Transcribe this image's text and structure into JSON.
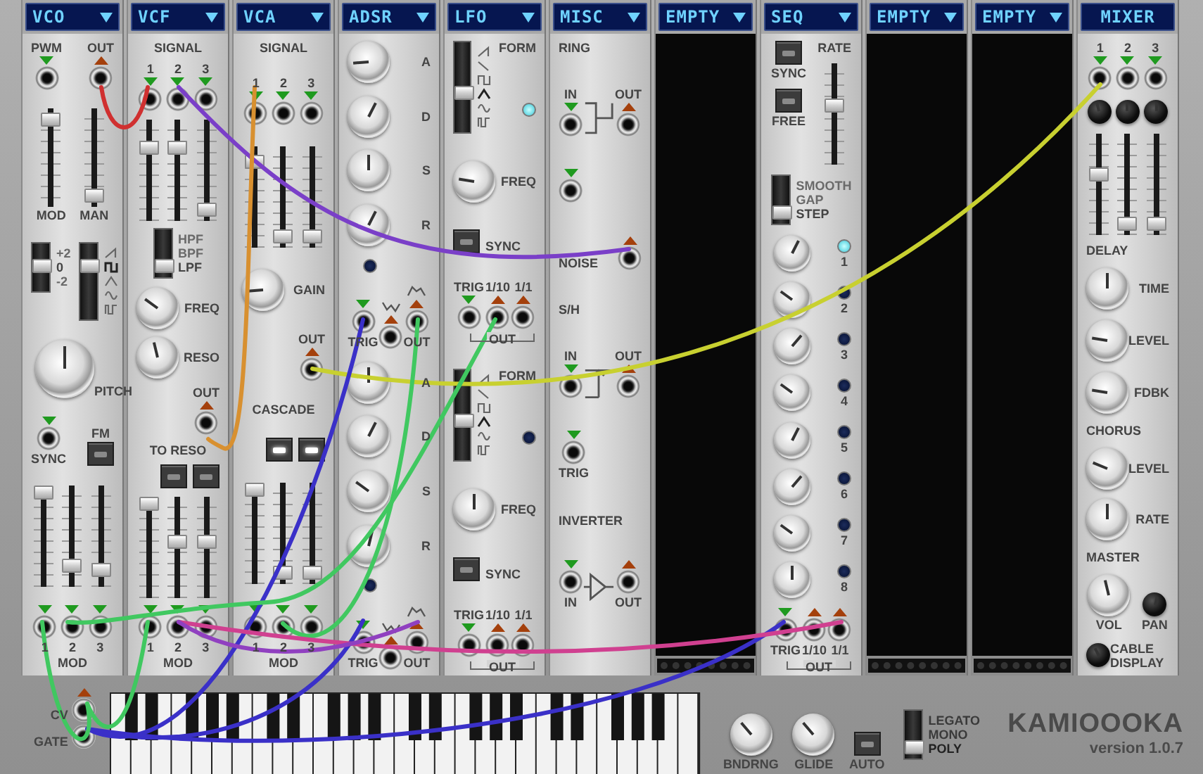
{
  "modules": [
    {
      "title": "VCO",
      "dropdown": true,
      "kind": "module",
      "rows": [
        {
          "kind": "jacks",
          "items": [
            {
              "kind": "input",
              "label": "PWM"
            },
            {
              "kind": "output",
              "label": "OUT"
            }
          ]
        },
        {
          "kind": "sliders",
          "sliders": [
            {
              "level": 0.95,
              "label": "MOD"
            },
            {
              "level": 0.05,
              "label": "MAN"
            }
          ]
        },
        {
          "kind": "columns",
          "columns": [
            [
              {
                "kind": "selector",
                "options": [
                  {
                    "text": "+2",
                    "selected": false
                  },
                  {
                    "text": "0",
                    "selected": true
                  },
                  {
                    "text": "-2",
                    "selected": false
                  }
                ]
              }
            ],
            [
              {
                "kind": "selector",
                "options": [
                  {
                    "kind": "saw",
                    "selected": false
                  },
                  {
                    "kind": "square",
                    "selected": true
                  },
                  {
                    "kind": "triangle",
                    "selected": false
                  },
                  {
                    "kind": "sine",
                    "selected": false
                  },
                  {
                    "kind": "pulse",
                    "selected": false
                  }
                ]
              }
            ]
          ]
        },
        {
          "kind": "big_knob",
          "label": "PITCH",
          "level": 0.5
        },
        {
          "kind": "jacks",
          "items": [
            {
              "kind": "input",
              "caption": "SYNC"
            },
            {
              "kind": "button",
              "label": "FM",
              "on": false
            }
          ]
        },
        {
          "kind": "sliders",
          "sliders": [
            {
              "level": 1
            },
            {
              "level": 0.15
            },
            {
              "level": 0.1
            }
          ]
        },
        {
          "kind": "jacks",
          "bottom": "MOD",
          "items": [
            {
              "kind": "input",
              "caption": "1"
            },
            {
              "kind": "input",
              "caption": "2"
            },
            {
              "kind": "input",
              "caption": "3"
            }
          ]
        }
      ]
    },
    {
      "title": "VCF",
      "dropdown": true,
      "kind": "module",
      "rows": [
        {
          "kind": "heading",
          "text": "SIGNAL"
        },
        {
          "kind": "jacks",
          "items": [
            {
              "kind": "input",
              "label": "1"
            },
            {
              "kind": "input",
              "label": "2"
            },
            {
              "kind": "input",
              "label": "3"
            }
          ]
        },
        {
          "kind": "sliders",
          "sliders": [
            {
              "level": 0.75
            },
            {
              "level": 0.75
            },
            {
              "level": 0.05
            }
          ]
        },
        {
          "kind": "selector",
          "options": [
            {
              "text": "HPF",
              "selected": false
            },
            {
              "text": "BPF",
              "selected": false
            },
            {
              "text": "LPF",
              "selected": true
            }
          ]
        },
        {
          "kind": "knob",
          "label": "FREQ",
          "level": 0.3
        },
        {
          "kind": "knob",
          "label": "RESO",
          "level": 0.45
        },
        {
          "kind": "jacks",
          "items": [
            {
              "kind": "output",
              "label": "OUT"
            }
          ]
        },
        {
          "kind": "heading",
          "text": "TO RESO"
        },
        {
          "kind": "jacks",
          "items": [
            {
              "kind": "button",
              "on": false
            },
            {
              "kind": "button",
              "on": false
            }
          ]
        },
        {
          "kind": "sliders",
          "sliders": [
            {
              "level": 1
            },
            {
              "level": 0.55
            },
            {
              "level": 0.55
            }
          ]
        },
        {
          "kind": "jacks",
          "bottom": "MOD",
          "items": [
            {
              "kind": "input",
              "caption": "1"
            },
            {
              "kind": "input",
              "caption": "2"
            },
            {
              "kind": "input",
              "caption": "3"
            }
          ]
        }
      ]
    },
    {
      "title": "VCA",
      "dropdown": true,
      "kind": "module",
      "rows": [
        {
          "kind": "heading",
          "text": "SIGNAL"
        },
        {
          "kind": "jacks",
          "items": [
            {
              "kind": "input",
              "label": "1"
            },
            {
              "kind": "input",
              "label": "2"
            },
            {
              "kind": "input",
              "label": "3"
            }
          ]
        },
        {
          "kind": "sliders",
          "sliders": [
            {
              "level": 0.9
            },
            {
              "level": 0.05
            },
            {
              "level": 0.05
            }
          ]
        },
        {
          "kind": "knob",
          "label": "GAIN",
          "level": 0.15
        },
        {
          "kind": "jacks",
          "items": [
            {
              "kind": "output",
              "label": "OUT"
            }
          ]
        },
        {
          "kind": "heading",
          "text": "CASCADE"
        },
        {
          "kind": "jacks",
          "items": [
            {
              "kind": "button",
              "on": true
            },
            {
              "kind": "button",
              "on": true
            }
          ]
        },
        {
          "kind": "sliders",
          "sliders": [
            {
              "level": 1
            },
            {
              "level": 0.05
            },
            {
              "level": 0.05
            }
          ]
        },
        {
          "kind": "jacks",
          "bottom": "MOD",
          "items": [
            {
              "kind": "input",
              "caption": "1"
            },
            {
              "kind": "input",
              "caption": "2"
            },
            {
              "kind": "input",
              "caption": "3"
            }
          ]
        }
      ]
    },
    {
      "title": "ADSR",
      "dropdown": true,
      "kind": "module",
      "rows": [
        {
          "kind": "knob",
          "label": "A",
          "level": 0.15
        },
        {
          "kind": "knob",
          "label": "D",
          "level": 0.6
        },
        {
          "kind": "knob",
          "label": "S",
          "level": 0.5
        },
        {
          "kind": "knob",
          "label": "R",
          "level": 0.6
        },
        {
          "kind": "led",
          "on": false
        },
        {
          "kind": "env_jacks",
          "items": [
            {
              "kind": "input",
              "caption": "TRIG"
            },
            {
              "kind": "output"
            },
            {
              "kind": "output",
              "caption": "OUT"
            }
          ]
        },
        {
          "kind": "knob",
          "label": "A",
          "level": 0.5
        },
        {
          "kind": "knob",
          "label": "D",
          "level": 0.6
        },
        {
          "kind": "knob",
          "label": "S",
          "level": 0.3
        },
        {
          "kind": "knob",
          "label": "R",
          "level": 0.55
        },
        {
          "kind": "led",
          "on": false
        },
        {
          "kind": "env_jacks",
          "items": [
            {
              "kind": "input",
              "caption": "TRIG"
            },
            {
              "kind": "output"
            },
            {
              "kind": "output",
              "caption": "OUT"
            }
          ]
        }
      ]
    },
    {
      "title": "LFO",
      "dropdown": true,
      "kind": "module",
      "rows": [
        {
          "kind": "selector",
          "title": "FORM",
          "led": {
            "on": true
          },
          "options": [
            {
              "kind": "saw",
              "selected": false
            },
            {
              "kind": "ramp",
              "selected": false
            },
            {
              "kind": "square",
              "selected": false
            },
            {
              "kind": "triangle",
              "selected": true
            },
            {
              "kind": "sine",
              "selected": false
            },
            {
              "kind": "pulse",
              "selected": false
            }
          ]
        },
        {
          "kind": "knob",
          "label": "FREQ",
          "level": 0.2
        },
        {
          "kind": "jacks",
          "items": [
            {
              "kind": "button",
              "on": false
            },
            {
              "kind": "text",
              "text": "SYNC"
            }
          ]
        },
        {
          "kind": "jacks",
          "group": "OUT",
          "items": [
            {
              "kind": "input",
              "label": "TRIG"
            },
            {
              "kind": "output",
              "label": "1/10"
            },
            {
              "kind": "output",
              "label": "1/1"
            }
          ]
        },
        {
          "kind": "selector",
          "title": "FORM",
          "led": {
            "on": false
          },
          "options": [
            {
              "kind": "saw",
              "selected": false
            },
            {
              "kind": "ramp",
              "selected": false
            },
            {
              "kind": "square",
              "selected": false
            },
            {
              "kind": "triangle",
              "selected": true
            },
            {
              "kind": "sine",
              "selected": false
            },
            {
              "kind": "pulse",
              "selected": false
            }
          ]
        },
        {
          "kind": "knob",
          "label": "FREQ",
          "level": 0.5
        },
        {
          "kind": "jacks",
          "items": [
            {
              "kind": "button",
              "on": false
            },
            {
              "kind": "text",
              "text": "SYNC"
            }
          ]
        },
        {
          "kind": "jacks",
          "group": "OUT",
          "items": [
            {
              "kind": "input",
              "label": "TRIG"
            },
            {
              "kind": "output",
              "label": "1/10"
            },
            {
              "kind": "output",
              "label": "1/1"
            }
          ]
        }
      ]
    },
    {
      "title": "MISC",
      "dropdown": true,
      "kind": "module",
      "rows": [
        {
          "kind": "heading",
          "text": "RING"
        },
        {
          "kind": "jacks",
          "items": [
            {
              "kind": "input",
              "label": "IN"
            },
            {
              "kind": "join"
            },
            {
              "kind": "output",
              "label": "OUT"
            }
          ]
        },
        {
          "kind": "jacks",
          "items": [
            {
              "kind": "input"
            }
          ]
        },
        {
          "kind": "jacks",
          "items": [
            {
              "kind": "text",
              "text": "NOISE"
            },
            {
              "kind": "output"
            }
          ]
        },
        {
          "kind": "heading",
          "text": "S/H"
        },
        {
          "kind": "jacks",
          "items": [
            {
              "kind": "input",
              "label": "IN"
            },
            {
              "kind": "sample"
            },
            {
              "kind": "output",
              "label": "OUT"
            }
          ]
        },
        {
          "kind": "jacks",
          "items": [
            {
              "kind": "input",
              "caption": "TRIG"
            }
          ]
        },
        {
          "kind": "heading",
          "text": "INVERTER"
        },
        {
          "kind": "jacks",
          "items": [
            {
              "kind": "input",
              "caption": "IN"
            },
            {
              "kind": "buffer"
            },
            {
              "kind": "output",
              "caption": "OUT"
            }
          ]
        },
        {
          "kind": "spacer"
        }
      ]
    },
    {
      "title": "EMPTY",
      "dropdown": true,
      "kind": "empty"
    },
    {
      "title": "SEQ",
      "dropdown": true,
      "kind": "module",
      "rows": [
        {
          "kind": "columns",
          "columns": [
            [
              {
                "kind": "jacks",
                "items": [
                  {
                    "kind": "button",
                    "on": false,
                    "caption": "SYNC"
                  }
                ]
              },
              {
                "kind": "jacks",
                "items": [
                  {
                    "kind": "button",
                    "on": false,
                    "caption": "FREE"
                  }
                ]
              }
            ],
            [
              {
                "kind": "heading",
                "text": "RATE"
              },
              {
                "kind": "sliders",
                "sliders": [
                  {
                    "level": 0.6
                  }
                ]
              }
            ]
          ]
        },
        {
          "kind": "selector",
          "options": [
            {
              "text": "SMOOTH",
              "selected": false
            },
            {
              "text": "GAP",
              "selected": false
            },
            {
              "text": "STEP",
              "selected": true
            }
          ]
        },
        {
          "kind": "step",
          "level": 0.6,
          "led": {
            "on": true
          },
          "step": "1"
        },
        {
          "kind": "step",
          "level": 0.3,
          "led": {
            "on": false
          },
          "step": "2"
        },
        {
          "kind": "step",
          "level": 0.65,
          "led": {
            "on": false
          },
          "step": "3"
        },
        {
          "kind": "step",
          "level": 0.3,
          "led": {
            "on": false
          },
          "step": "4"
        },
        {
          "kind": "step",
          "level": 0.6,
          "led": {
            "on": false
          },
          "step": "5"
        },
        {
          "kind": "step",
          "level": 0.65,
          "led": {
            "on": false
          },
          "step": "6"
        },
        {
          "kind": "step",
          "level": 0.3,
          "led": {
            "on": false
          },
          "step": "7"
        },
        {
          "kind": "step",
          "level": 0.5,
          "led": {
            "on": false
          },
          "step": "8"
        },
        {
          "kind": "jacks",
          "group": "OUT",
          "items": [
            {
              "kind": "input",
              "caption": "TRIG"
            },
            {
              "kind": "output",
              "caption": "1/10"
            },
            {
              "kind": "output",
              "caption": "1/1"
            }
          ]
        }
      ]
    },
    {
      "title": "EMPTY",
      "dropdown": true,
      "kind": "empty"
    },
    {
      "title": "EMPTY",
      "dropdown": true,
      "kind": "empty"
    },
    {
      "title": "MIXER",
      "dropdown": false,
      "kind": "module",
      "rows": [
        {
          "kind": "jacks",
          "items": [
            {
              "kind": "input",
              "label": "1"
            },
            {
              "kind": "input",
              "label": "2"
            },
            {
              "kind": "input",
              "label": "3"
            }
          ]
        },
        {
          "kind": "mini_knobs",
          "knobs": [
            {
              "level": 0.45
            },
            {
              "level": 0.5
            },
            {
              "level": 0.5
            }
          ]
        },
        {
          "kind": "sliders",
          "sliders": [
            {
              "level": 0.6
            },
            {
              "level": 0.05
            },
            {
              "level": 0.05
            }
          ]
        },
        {
          "kind": "heading",
          "text": "DELAY"
        },
        {
          "kind": "knob",
          "label": "TIME",
          "level": 0.5
        },
        {
          "kind": "knob",
          "label": "LEVEL",
          "level": 0.2
        },
        {
          "kind": "knob",
          "label": "FDBK",
          "level": 0.2
        },
        {
          "kind": "heading",
          "text": "CHORUS"
        },
        {
          "kind": "knob",
          "label": "LEVEL",
          "level": 0.25
        },
        {
          "kind": "knob",
          "label": "RATE",
          "level": 0.5
        },
        {
          "kind": "heading",
          "text": "MASTER"
        },
        {
          "kind": "knob_pair",
          "knobs": [
            {
              "kind": "knob",
              "caption": "VOL",
              "level": 0.45
            },
            {
              "kind": "mini_knob",
              "caption": "PAN",
              "level": 0.55
            }
          ]
        },
        {
          "kind": "mini_knob",
          "label": "CABLE DISPLAY",
          "level": 0.4
        }
      ]
    }
  ],
  "bottom": {
    "jacks": [
      {
        "label": "CV",
        "kind": "output"
      },
      {
        "label": "GATE",
        "kind": "plain"
      }
    ],
    "knobs": [
      {
        "caption": "BNDRNG",
        "level": 0.35
      },
      {
        "caption": "GLIDE",
        "level": 0.35
      }
    ],
    "auto": {
      "caption": "AUTO",
      "on": false
    },
    "mode": {
      "options": [
        {
          "text": "LEGATO",
          "selected": false
        },
        {
          "text": "MONO",
          "selected": false
        },
        {
          "text": "POLY",
          "selected": true
        }
      ]
    },
    "brand": "KAMIOOOKA",
    "version": "version 1.0.7"
  }
}
